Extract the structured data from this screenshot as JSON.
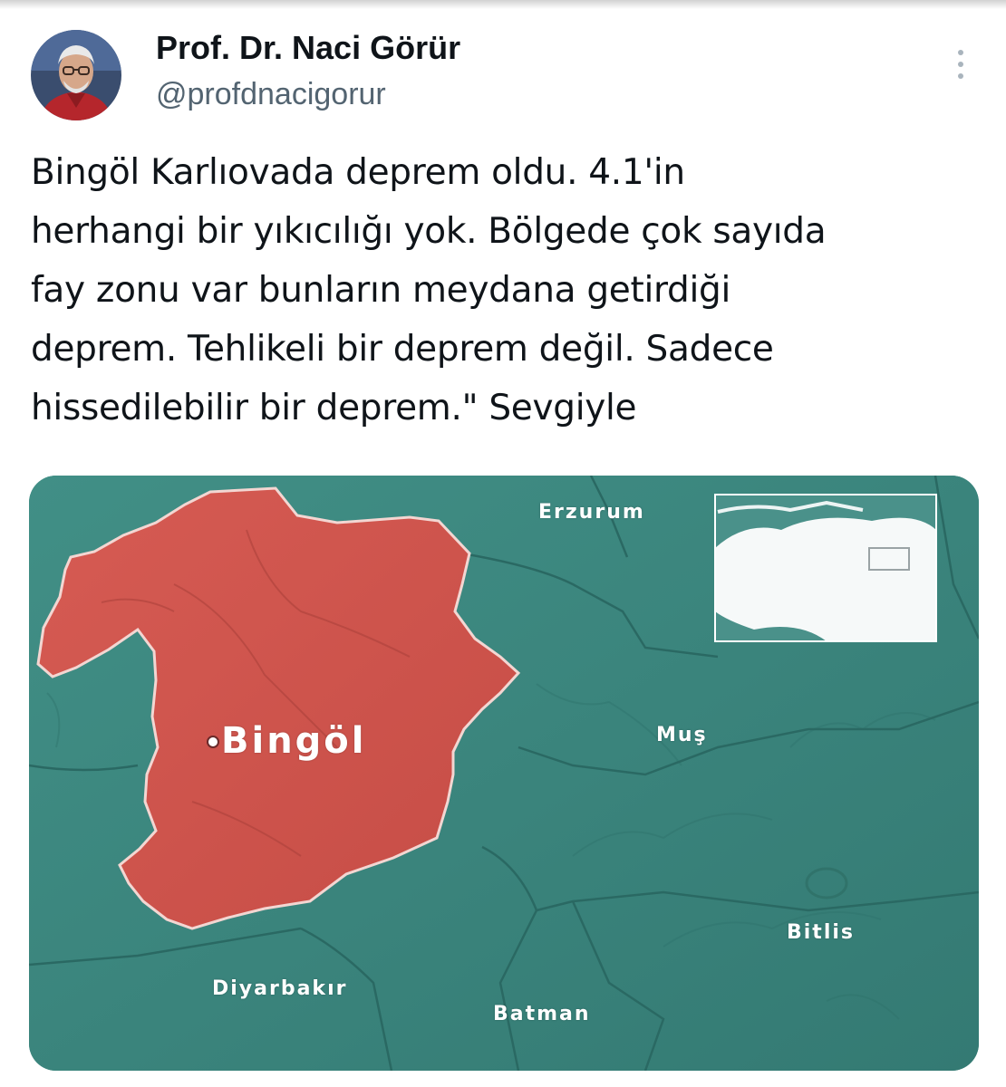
{
  "tweet": {
    "author_name": "Prof. Dr. Naci Görür",
    "author_handle": "@profdnacigorur",
    "text": "Bingöl Karlıovada deprem oldu. 4.1'in\nherhangi bir yıkıcılığı yok. Bölgede çok sayıda\nfay zonu var bunların meydana getirdiği\ndeprem. Tehlikeli bir deprem değil. Sadece\nhissedilebilir bir deprem.\" Sevgiyle",
    "more_icon": "more-vertical-icon"
  },
  "map": {
    "highlighted_province": "Bingöl",
    "labels": {
      "erzurum": "Erzurum",
      "bingol": "Bingöl",
      "mus": "Muş",
      "bitlis": "Bitlis",
      "diyarbakir": "Diyarbakır",
      "batman": "Batman"
    },
    "colors": {
      "background": "#3d8a82",
      "province_fill": "#d0574f",
      "border": "#2c6c66",
      "label": "#ffffff"
    }
  }
}
